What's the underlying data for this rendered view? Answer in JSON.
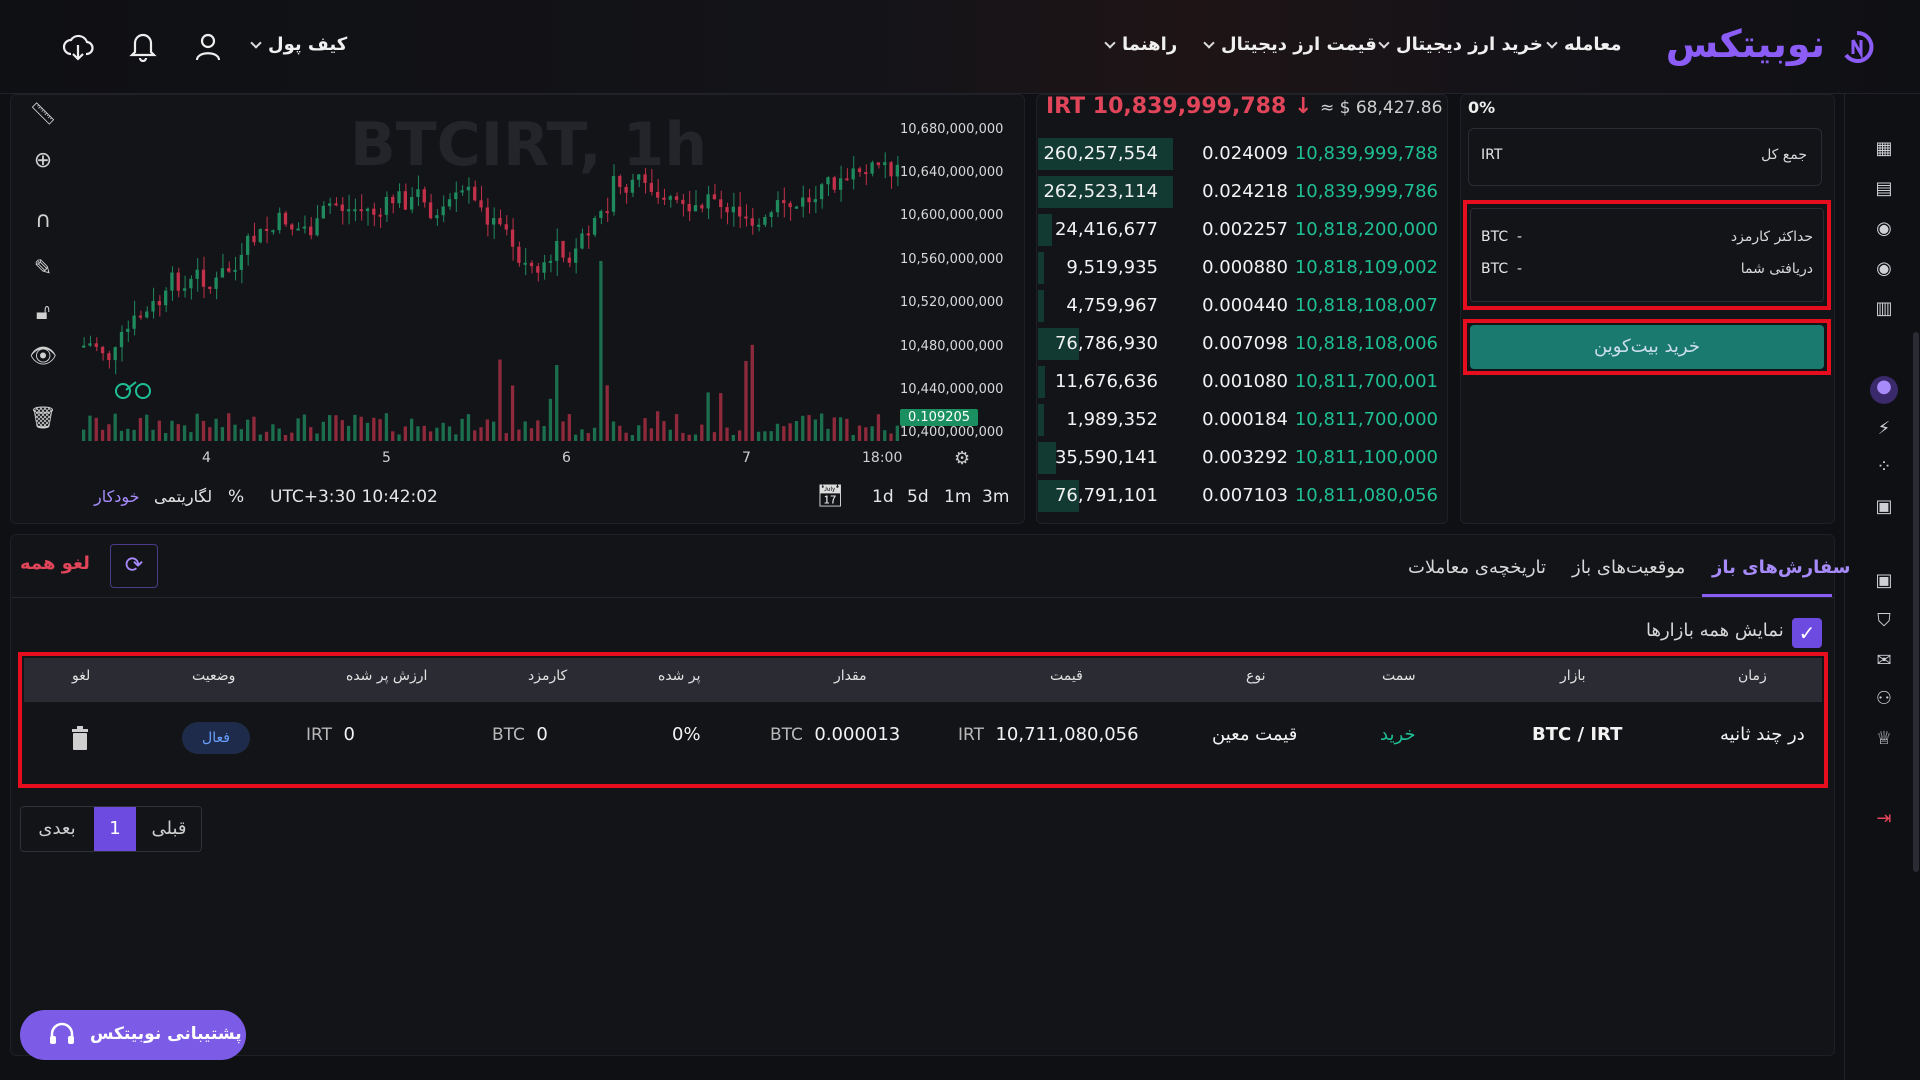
{
  "nav": {
    "logo": "نوبیتکس",
    "items": [
      "معامله",
      "خرید ارز دیجیتال",
      "قیمت ارز دیجیتال",
      "راهنما"
    ],
    "wallet": "کیف پول"
  },
  "chart": {
    "watermark": "BTCIRT, 1h",
    "price_ticks": [
      "10,680,000,000",
      "10,640,000,000",
      "10,600,000,000",
      "10,560,000,000",
      "10,520,000,000",
      "10,480,000,000",
      "10,440,000,000",
      "10,400,000,000"
    ],
    "x_ticks": [
      "4",
      "5",
      "6",
      "7",
      "18:00"
    ],
    "price_badge": "0.109205",
    "timeframes": [
      "1d",
      "5d",
      "1m",
      "3m"
    ],
    "timezone": "UTC+3:30 10:42:02",
    "percent": "%",
    "log": "لگاریتمی",
    "auto": "خودکار"
  },
  "orderbook": {
    "last_price": "IRT 10,839,999,788",
    "usd_price": "≈ $ 68,427.86",
    "rows": [
      {
        "total": "260,257,554",
        "amount": "0.024009",
        "price": "10,839,999,788",
        "depth": 0.3
      },
      {
        "total": "262,523,114",
        "amount": "0.024218",
        "price": "10,839,999,786",
        "depth": 0.3
      },
      {
        "total": "24,416,677",
        "amount": "0.002257",
        "price": "10,818,200,000",
        "depth": 0.03
      },
      {
        "total": "9,519,935",
        "amount": "0.000880",
        "price": "10,818,109,002",
        "depth": 0.012
      },
      {
        "total": "4,759,967",
        "amount": "0.000440",
        "price": "10,818,108,007",
        "depth": 0.006
      },
      {
        "total": "76,786,930",
        "amount": "0.007098",
        "price": "10,818,108,006",
        "depth": 0.09
      },
      {
        "total": "11,676,636",
        "amount": "0.001080",
        "price": "10,811,700,001",
        "depth": 0.015
      },
      {
        "total": "1,989,352",
        "amount": "0.000184",
        "price": "10,811,700,000",
        "depth": 0.004
      },
      {
        "total": "35,590,141",
        "amount": "0.003292",
        "price": "10,811,100,000",
        "depth": 0.04
      },
      {
        "total": "76,791,101",
        "amount": "0.007103",
        "price": "10,811,080,056",
        "depth": 0.09
      }
    ]
  },
  "form": {
    "percent": "0%",
    "total_label": "جمع کل",
    "total_unit": "IRT",
    "max_fee_label": "حداکثر کارمزد",
    "max_fee_value": "BTC  -",
    "receive_label": "دریافتی شما",
    "receive_value": "BTC  -",
    "buy_button": "خرید بیت‌کوین"
  },
  "orders": {
    "tabs": [
      "سفارش‌های باز",
      "موقعیت‌های باز",
      "تاریخچه‌ی معاملات"
    ],
    "cancel_all": "لغو همه",
    "show_all_markets": "نمایش همه بازارها",
    "headers": [
      "زمان",
      "بازار",
      "سمت",
      "نوع",
      "قیمت",
      "مقدار",
      "پر شده",
      "کارمزد",
      "ارزش پر شده",
      "وضعیت",
      "لغو"
    ],
    "row": {
      "time": "در چند ثانیه",
      "market": "BTC / IRT",
      "side": "خرید",
      "type": "قیمت معین",
      "price_unit": "IRT",
      "price": "10,711,080,056",
      "amount_unit": "BTC",
      "amount": "0.000013",
      "filled": "0%",
      "fee_unit": "BTC",
      "fee": "0",
      "value_unit": "IRT",
      "value": "0",
      "status": "فعال"
    },
    "pagination": {
      "prev": "قبلی",
      "page": "1",
      "next": "بعدی"
    }
  },
  "support": "پشتیبانی نوبیتکس",
  "colors": {
    "accent": "#8b5cf6",
    "green": "#1fbf95",
    "red": "#e0455a",
    "buy": "#1a7a70",
    "highlight": "#e60d1e"
  }
}
